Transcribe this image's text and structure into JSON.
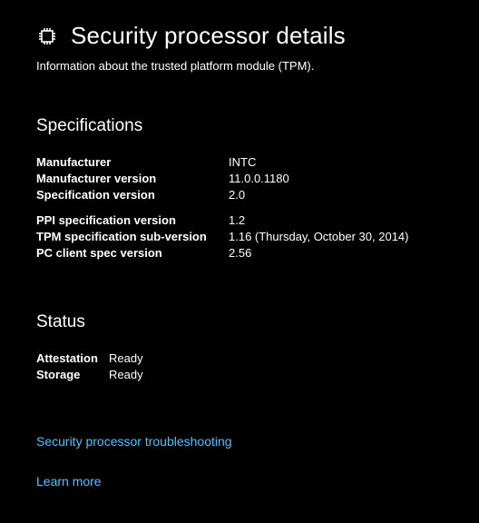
{
  "header": {
    "title": "Security processor details",
    "subtitle": "Information about the trusted platform module (TPM)."
  },
  "specs": {
    "heading": "Specifications",
    "group1": [
      {
        "label": "Manufacturer",
        "value": "INTC"
      },
      {
        "label": "Manufacturer version",
        "value": "11.0.0.1180"
      },
      {
        "label": "Specification version",
        "value": "2.0"
      }
    ],
    "group2": [
      {
        "label": "PPI specification version",
        "value": "1.2"
      },
      {
        "label": "TPM specification sub-version",
        "value": "1.16 (Thursday, October 30, 2014)"
      },
      {
        "label": "PC client spec version",
        "value": "2.56"
      }
    ]
  },
  "status": {
    "heading": "Status",
    "rows": [
      {
        "label": "Attestation",
        "value": "Ready"
      },
      {
        "label": "Storage",
        "value": "Ready"
      }
    ]
  },
  "links": {
    "troubleshoot": "Security processor troubleshooting",
    "learn": "Learn more"
  }
}
